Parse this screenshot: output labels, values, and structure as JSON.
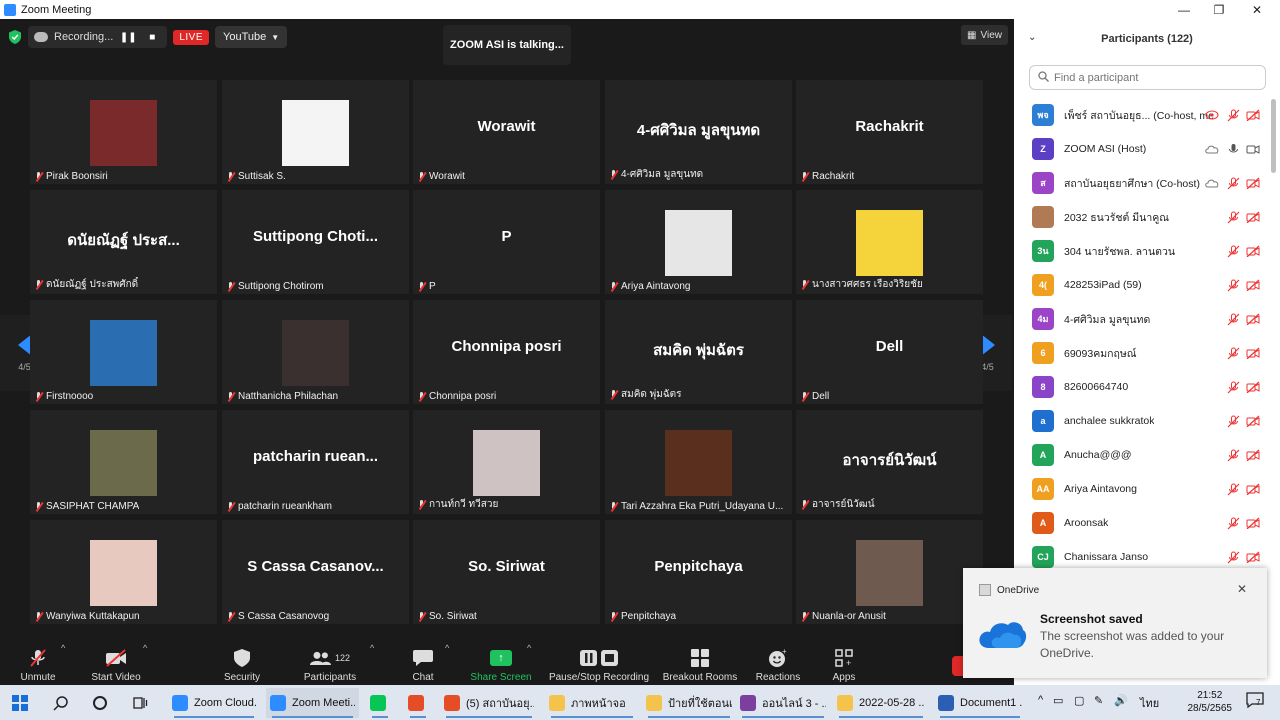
{
  "window": {
    "title": "Zoom Meeting"
  },
  "meeting": {
    "recording_label": "Recording...",
    "live_badge": "LIVE",
    "stream_target": "YouTube",
    "talking": "ZOOM ASI is talking...",
    "view_label": "View",
    "page_left": "4/5",
    "page_right": "4/5"
  },
  "tiles": [
    {
      "big": "",
      "label": "Pirak Boonsiri",
      "photo": "#7a2a2a"
    },
    {
      "big": "",
      "label": "Suttisak S.",
      "photo": "#f4f4f4"
    },
    {
      "big": "Worawit",
      "label": "Worawit",
      "photo": ""
    },
    {
      "big": "4-ศศิวิมล มูลขุนทด",
      "label": "4-ศศิวิมล มูลขุนทด",
      "photo": ""
    },
    {
      "big": "Rachakrit",
      "label": "Rachakrit",
      "photo": ""
    },
    {
      "big": "ดนัยณัฏฐ์ ประส...",
      "label": "ดนัยณัฏฐ์ ประสพศักดิ์",
      "photo": ""
    },
    {
      "big": "Suttipong Choti...",
      "label": "Suttipong Chotirom",
      "photo": ""
    },
    {
      "big": "P",
      "label": "P",
      "photo": ""
    },
    {
      "big": "",
      "label": "Ariya Aintavong",
      "photo": "#e6e6e6"
    },
    {
      "big": "",
      "label": "นางสาวศศธร เรืองวิริยชัย",
      "photo": "#f5d33a"
    },
    {
      "big": "",
      "label": "Firstnoooo",
      "photo": "#2a6db0"
    },
    {
      "big": "",
      "label": "Natthanicha Philachan",
      "photo": "#3a3030"
    },
    {
      "big": "Chonnipa posri",
      "label": "Chonnipa posri",
      "photo": ""
    },
    {
      "big": "สมคิด พุ่มฉัตร",
      "label": "สมคิด พุ่มฉัตร",
      "photo": ""
    },
    {
      "big": "Dell",
      "label": "Dell",
      "photo": ""
    },
    {
      "big": "",
      "label": "SASIPHAT CHAMPA",
      "photo": "#6b6a4a"
    },
    {
      "big": "patcharin ruean...",
      "label": "patcharin rueankham",
      "photo": ""
    },
    {
      "big": "",
      "label": "กานท์กวี ทวีสวย",
      "photo": "#cfc2c2"
    },
    {
      "big": "",
      "label": "Tari Azzahra Eka Putri_Udayana U...",
      "photo": "#5a2f1d"
    },
    {
      "big": "อาจารย์นิวัฒน์",
      "label": "อาจารย์นิวัฒน์",
      "photo": ""
    },
    {
      "big": "",
      "label": "Wanyiwa Kuttakapun",
      "photo": "#e8c9c0"
    },
    {
      "big": "S Cassa Casanov...",
      "label": "S Cassa Casanovog",
      "photo": ""
    },
    {
      "big": "So. Siriwat",
      "label": "So. Siriwat",
      "photo": ""
    },
    {
      "big": "Penpitchaya",
      "label": "Penpitchaya",
      "photo": ""
    },
    {
      "big": "",
      "label": "Nuanla-or Anusit",
      "photo": "#6e5a4e"
    }
  ],
  "toolbar": {
    "unmute": "Unmute",
    "start_video": "Start Video",
    "security": "Security",
    "participants": "Participants",
    "participants_count": "122",
    "chat": "Chat",
    "share_screen": "Share Screen",
    "pause_recording": "Pause/Stop Recording",
    "breakout": "Breakout Rooms",
    "reactions": "Reactions",
    "apps": "Apps"
  },
  "panel": {
    "title": "Participants (122)",
    "search_placeholder": "Find a participant",
    "participants": [
      {
        "initials": "พจ",
        "name": "เพ็ชร์ สถาบันอยุธ... (Co-host, me)",
        "color": "#2d7fd6",
        "muted": true,
        "icons": "rec"
      },
      {
        "initials": "Z",
        "name": "ZOOM ASI (Host)",
        "color": "#5b3fc4",
        "muted": false,
        "icons": "host"
      },
      {
        "initials": "ส",
        "name": "สถาบันอยุธยาศึกษา (Co-host)",
        "color": "#9b44c8",
        "muted": true,
        "icons": "cloud"
      },
      {
        "initials": "",
        "name": "2032 ธนวรัชต์ มีนาคูณ",
        "color": "#b07a55",
        "muted": true,
        "icons": ""
      },
      {
        "initials": "3น",
        "name": "304 นายรัชพล. ลานตวน",
        "color": "#22a45a",
        "muted": true,
        "icons": ""
      },
      {
        "initials": "4(",
        "name": "428253iPad (59)",
        "color": "#f0a020",
        "muted": true,
        "icons": ""
      },
      {
        "initials": "4ม",
        "name": "4-ศศิวิมล มูลขุนทด",
        "color": "#9b44c8",
        "muted": true,
        "icons": ""
      },
      {
        "initials": "6",
        "name": "69093คมกฤษณ์",
        "color": "#f0a020",
        "muted": true,
        "icons": ""
      },
      {
        "initials": "8",
        "name": "82600664740",
        "color": "#8a44c8",
        "muted": true,
        "icons": ""
      },
      {
        "initials": "a",
        "name": "anchalee sukkratok",
        "color": "#1f6fd0",
        "muted": true,
        "icons": ""
      },
      {
        "initials": "A",
        "name": "Anucha@@@",
        "color": "#22a45a",
        "muted": true,
        "icons": ""
      },
      {
        "initials": "AA",
        "name": "Ariya Aintavong",
        "color": "#f0a020",
        "muted": true,
        "icons": ""
      },
      {
        "initials": "A",
        "name": "Aroonsak",
        "color": "#e05a1a",
        "muted": true,
        "icons": ""
      },
      {
        "initials": "CJ",
        "name": "Chanissara Janso",
        "color": "#22a45a",
        "muted": true,
        "icons": ""
      }
    ]
  },
  "toast": {
    "app": "OneDrive",
    "title": "Screenshot saved",
    "body": "The screenshot was added to your OneDrive."
  },
  "taskbar": {
    "apps": [
      {
        "label": "Zoom Cloud...",
        "color": "#2d8cff"
      },
      {
        "label": "Zoom Meeti...",
        "color": "#2d8cff"
      },
      {
        "label": "",
        "color": "#06c755"
      },
      {
        "label": "",
        "color": "#e44d26"
      },
      {
        "label": "(5) สถาบันอยุ...",
        "color": "#e44d26"
      },
      {
        "label": "ภาพหน้าจอ",
        "color": "#f3c34b"
      },
      {
        "label": "ป้ายที่ใช้ตอนเ...",
        "color": "#f3c34b"
      },
      {
        "label": "ออนไลน์ 3 - ...",
        "color": "#7b3fa0"
      },
      {
        "label": "2022-05-28 ...",
        "color": "#f3c34b"
      },
      {
        "label": "Document1 ...",
        "color": "#2b5fb4"
      }
    ],
    "lang": "ไทย",
    "time": "21:52",
    "date": "28/5/2565",
    "notif_count": "7"
  }
}
